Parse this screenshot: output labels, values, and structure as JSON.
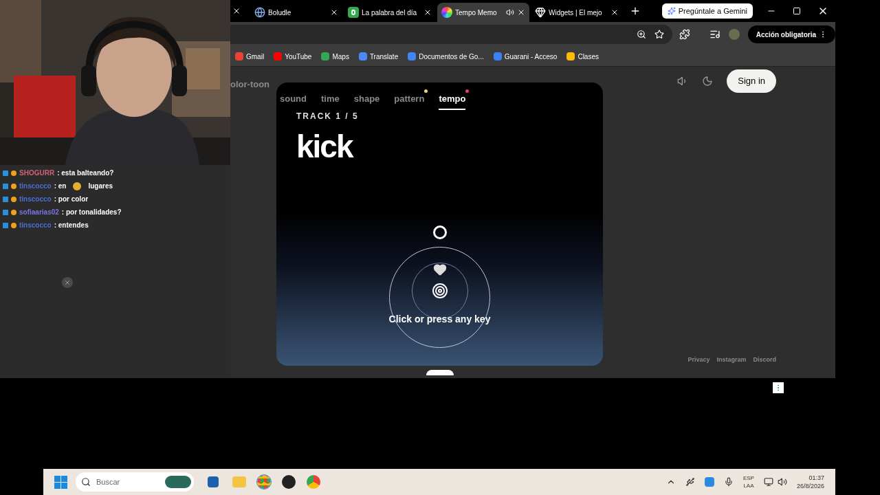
{
  "browser": {
    "tabs": [
      {
        "title": "Boludle",
        "kind": "globe",
        "selected": false,
        "audio": false
      },
      {
        "title": "La palabra del día",
        "kind": "letter",
        "selected": false,
        "audio": false
      },
      {
        "title": "Tempo Memo",
        "kind": "wheel",
        "selected": true,
        "audio": true
      },
      {
        "title": "Widgets | El mejo",
        "kind": "gem",
        "selected": false,
        "audio": false
      }
    ],
    "gemini_button": "Pregúntale a Gemini",
    "action_button": "Acción obligatoria",
    "bookmarks": [
      {
        "label": "Gmail",
        "color": "#ea4335"
      },
      {
        "label": "YouTube",
        "color": "#ff0000"
      },
      {
        "label": "Maps",
        "color": "#34a853"
      },
      {
        "label": "Translate",
        "color": "#4a8af4"
      },
      {
        "label": "Documentos de Go...",
        "color": "#4285f4"
      },
      {
        "label": "Guarani - Acceso",
        "color": "#3b82f6"
      },
      {
        "label": "Clases",
        "color": "#fbbc04"
      }
    ]
  },
  "page": {
    "partial_tab": "olor-toon",
    "tabs": [
      {
        "label": "sound",
        "selected": false
      },
      {
        "label": "time",
        "selected": false
      },
      {
        "label": "shape",
        "selected": false
      },
      {
        "label": "pattern",
        "selected": false,
        "color": "#e6d96b"
      },
      {
        "label": "tempo",
        "selected": true,
        "color": "#e0406a"
      }
    ],
    "track": "TRACK 1 / 5",
    "word": "kick",
    "prompt": "Click or press any key",
    "sign_in": "Sign in",
    "footer": [
      "Privacy",
      "Instagram",
      "Discord"
    ]
  },
  "chat": [
    {
      "user": "SHOGURR",
      "color": "#d0607a",
      "text": ": esta balteando?"
    },
    {
      "user": "tinscocco",
      "color": "#4a6fd0",
      "text": ": en",
      "emote": true,
      "text_after": "lugares"
    },
    {
      "user": "tinscocco",
      "color": "#4a6fd0",
      "text": ": por color"
    },
    {
      "user": "sofiaarias02",
      "color": "#7b74e0",
      "text": ": por tonalidades?"
    },
    {
      "user": "tinscocco",
      "color": "#4a6fd0",
      "text": ": entendes"
    }
  ],
  "taskbar": {
    "search_placeholder": "Buscar",
    "language": "ESP",
    "layout": "LAA",
    "time": "01:37",
    "date": "26/8/2026"
  }
}
